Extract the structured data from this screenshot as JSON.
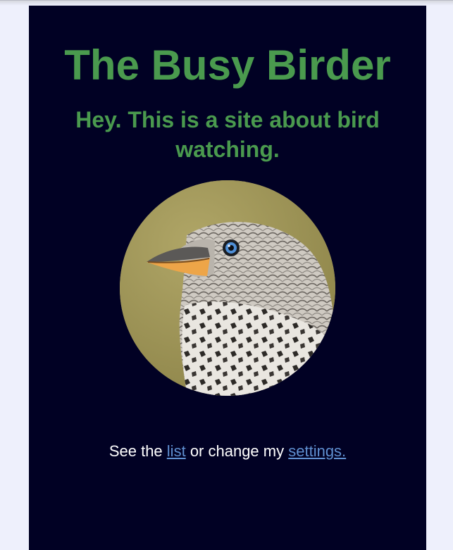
{
  "header": {
    "title": "The Busy Birder",
    "tagline": "Hey. This is a site about bird watching."
  },
  "hero": {
    "image_icon": "bird-photo"
  },
  "nav": {
    "prefix": "See the",
    "list_link": "list",
    "middle": "or change my",
    "settings_link": "settings."
  },
  "colors": {
    "background": "#eef0fc",
    "panel": "#010124",
    "heading": "#4a9a4e",
    "link": "#5f8fd0",
    "text": "#ffffff"
  }
}
